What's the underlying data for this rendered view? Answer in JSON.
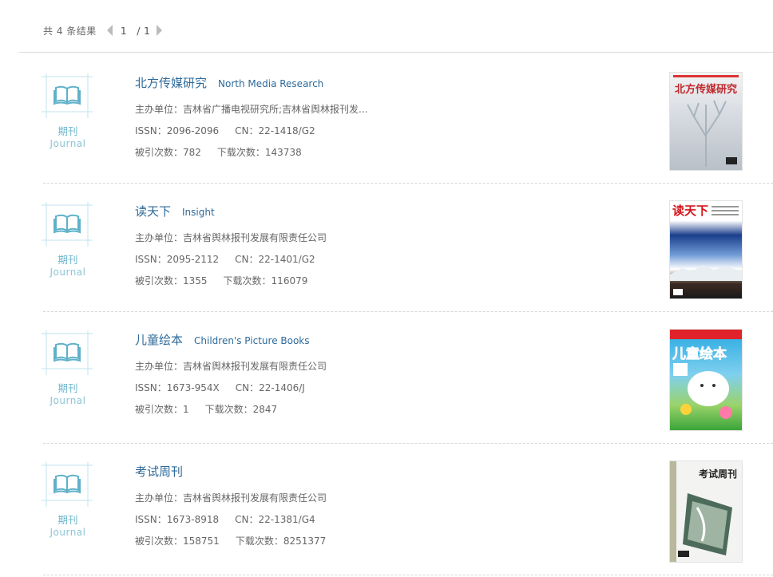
{
  "results": {
    "summary": "共 4 条结果",
    "page_current": "1",
    "page_sep": "/",
    "page_total": "1"
  },
  "badge": {
    "zh": "期刊",
    "en": "Journal"
  },
  "items": [
    {
      "title_zh": "北方传媒研究",
      "title_en": "North Media Research",
      "sponsor": "主办单位：吉林省广播电视研究所;吉林省舆林报刊发...",
      "issn": "ISSN：2096-2096",
      "cn": "CN：22-1418/G2",
      "cited": "被引次数：782",
      "downloads": "下载次数：143738",
      "cover_text": "北方传媒研究"
    },
    {
      "title_zh": "读天下",
      "title_en": "Insight",
      "sponsor": "主办单位：吉林省舆林报刊发展有限责任公司",
      "issn": "ISSN：2095-2112",
      "cn": "CN：22-1401/G2",
      "cited": "被引次数：1355",
      "downloads": "下载次数：116079",
      "cover_text": "读天下"
    },
    {
      "title_zh": "儿童绘本",
      "title_en": "Children's Picture Books",
      "sponsor": "主办单位：吉林省舆林报刊发展有限责任公司",
      "issn": "ISSN：1673-954X",
      "cn": "CN：22-1406/J",
      "cited": "被引次数：1",
      "downloads": "下载次数：2847",
      "cover_text": "儿童绘本"
    },
    {
      "title_zh": "考试周刊",
      "title_en": "",
      "sponsor": "主办单位：吉林省舆林报刊发展有限责任公司",
      "issn": "ISSN：1673-8918",
      "cn": "CN：22-1381/G4",
      "cited": "被引次数：158751",
      "downloads": "下载次数：8251377",
      "cover_text": "考试周刊"
    }
  ],
  "colors": {
    "accent": "#2d6a9a",
    "badge": "#6fb7cc"
  }
}
